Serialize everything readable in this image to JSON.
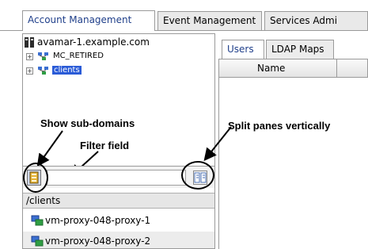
{
  "main_tabs": [
    {
      "label": "Account Management",
      "active": true
    },
    {
      "label": "Event Management",
      "active": false
    },
    {
      "label": "Services Admi",
      "active": false
    }
  ],
  "tree": {
    "server": "avamar-1.example.com",
    "nodes": [
      {
        "label": "MC_RETIRED",
        "selected": false
      },
      {
        "label": "clients",
        "selected": true
      }
    ]
  },
  "annotations": {
    "show_subdomains": "Show sub-domains",
    "filter_field": "Filter field",
    "split_panes": "Split panes vertically"
  },
  "filter": {
    "value": ""
  },
  "client_list": {
    "path": "/clients",
    "items": [
      "vm-proxy-048-proxy-1",
      "vm-proxy-048-proxy-2"
    ]
  },
  "right_pane": {
    "tabs": [
      {
        "label": "Users",
        "active": true
      },
      {
        "label": "LDAP Maps",
        "active": false
      }
    ],
    "columns": [
      "Name",
      ""
    ]
  },
  "colors": {
    "selection": "#2a5bd7",
    "active_tab_text": "#1f3f8a"
  }
}
